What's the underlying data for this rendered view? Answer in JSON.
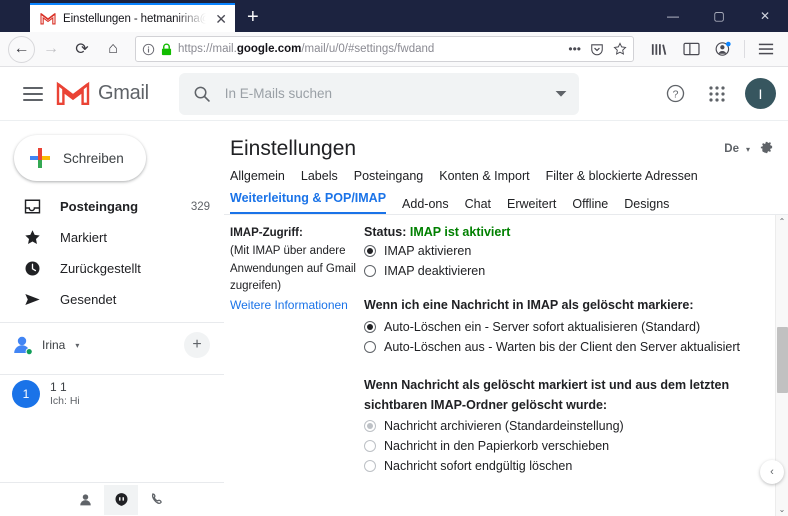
{
  "browser": {
    "tab": {
      "title": "Einstellungen - hetmanirina@g",
      "favicon": "gmail-icon",
      "close": "✕"
    },
    "newtab_label": "+",
    "window_controls": {
      "minimize": "—",
      "maximize": "▢",
      "close": "✕"
    },
    "url": {
      "scheme": "https://mail.",
      "domain": "google.com",
      "path": "/mail/u/0/#settings/fwdand"
    },
    "nav": {
      "back": "←",
      "forward": "→",
      "reload": "⟳",
      "home": "⌂"
    },
    "toolbar_icons": [
      "library-icon",
      "sidebar-icon",
      "account-icon",
      "menu-icon"
    ]
  },
  "gmail": {
    "logo_text": "Gmail",
    "search": {
      "placeholder": "In E-Mails suchen",
      "icon": "search-icon",
      "dropdown": "▼"
    },
    "header_right": {
      "help": "?",
      "apps": "apps-grid-icon",
      "avatar_initial": "I"
    }
  },
  "sidebar": {
    "compose": "Schreiben",
    "items": [
      {
        "label": "Posteingang",
        "count": "329",
        "icon": "inbox-icon",
        "active": true
      },
      {
        "label": "Markiert",
        "count": "",
        "icon": "star-icon",
        "active": false
      },
      {
        "label": "Zurückgestellt",
        "count": "",
        "icon": "clock-icon",
        "active": false
      },
      {
        "label": "Gesendet",
        "count": "",
        "icon": "send-icon",
        "active": false
      }
    ],
    "hangouts": {
      "name": "Irina",
      "caret": "▾",
      "add": "+"
    },
    "conversation": {
      "badge": "1",
      "title": "1 1",
      "preview": "Ich: Hi"
    },
    "footer_icons": [
      "contacts-icon",
      "chat-icon",
      "phone-icon"
    ]
  },
  "settings": {
    "title": "Einstellungen",
    "language": "De",
    "language_caret": "▾",
    "gear": "gear-icon",
    "tabs_row1": [
      "Allgemein",
      "Labels",
      "Posteingang",
      "Konten & Import",
      "Filter & blockierte Adressen"
    ],
    "tabs_row2": [
      "Weiterleitung & POP/IMAP",
      "Add-ons",
      "Chat",
      "Erweitert",
      "Offline",
      "Designs"
    ],
    "active_tab": "Weiterleitung & POP/IMAP",
    "imap": {
      "label": "IMAP-Zugriff:",
      "desc_line1": "(Mit IMAP über andere",
      "desc_line2": "Anwendungen auf Gmail",
      "desc_line3": "zugreifen)",
      "more_link": "Weitere Informationen",
      "status_prefix": "Status:",
      "status_value": "IMAP ist aktiviert",
      "status_color": "#008000",
      "options": [
        {
          "label": "IMAP aktivieren",
          "checked": true,
          "disabled": false
        },
        {
          "label": "IMAP deaktivieren",
          "checked": false,
          "disabled": false
        }
      ],
      "question1": "Wenn ich eine Nachricht in IMAP als gelöscht markiere:",
      "question1_options": [
        {
          "label": "Auto-Löschen ein - Server sofort aktualisieren (Standard)",
          "checked": true,
          "disabled": false
        },
        {
          "label": "Auto-Löschen aus - Warten bis der Client den Server aktualisiert",
          "checked": false,
          "disabled": false
        }
      ],
      "question2_line1": "Wenn Nachricht als gelöscht markiert ist und aus dem letzten",
      "question2_line2": "sichtbaren IMAP-Ordner gelöscht wurde:",
      "question2_options": [
        {
          "label": "Nachricht archivieren (Standardeinstellung)",
          "checked": true,
          "disabled": true
        },
        {
          "label": "Nachricht in den Papierkorb verschieben",
          "checked": false,
          "disabled": true
        },
        {
          "label": "Nachricht sofort endgültig löschen",
          "checked": false,
          "disabled": true
        }
      ]
    },
    "scrollbar": {
      "up": "⌃",
      "down": "⌄"
    },
    "collapse": "‹"
  }
}
